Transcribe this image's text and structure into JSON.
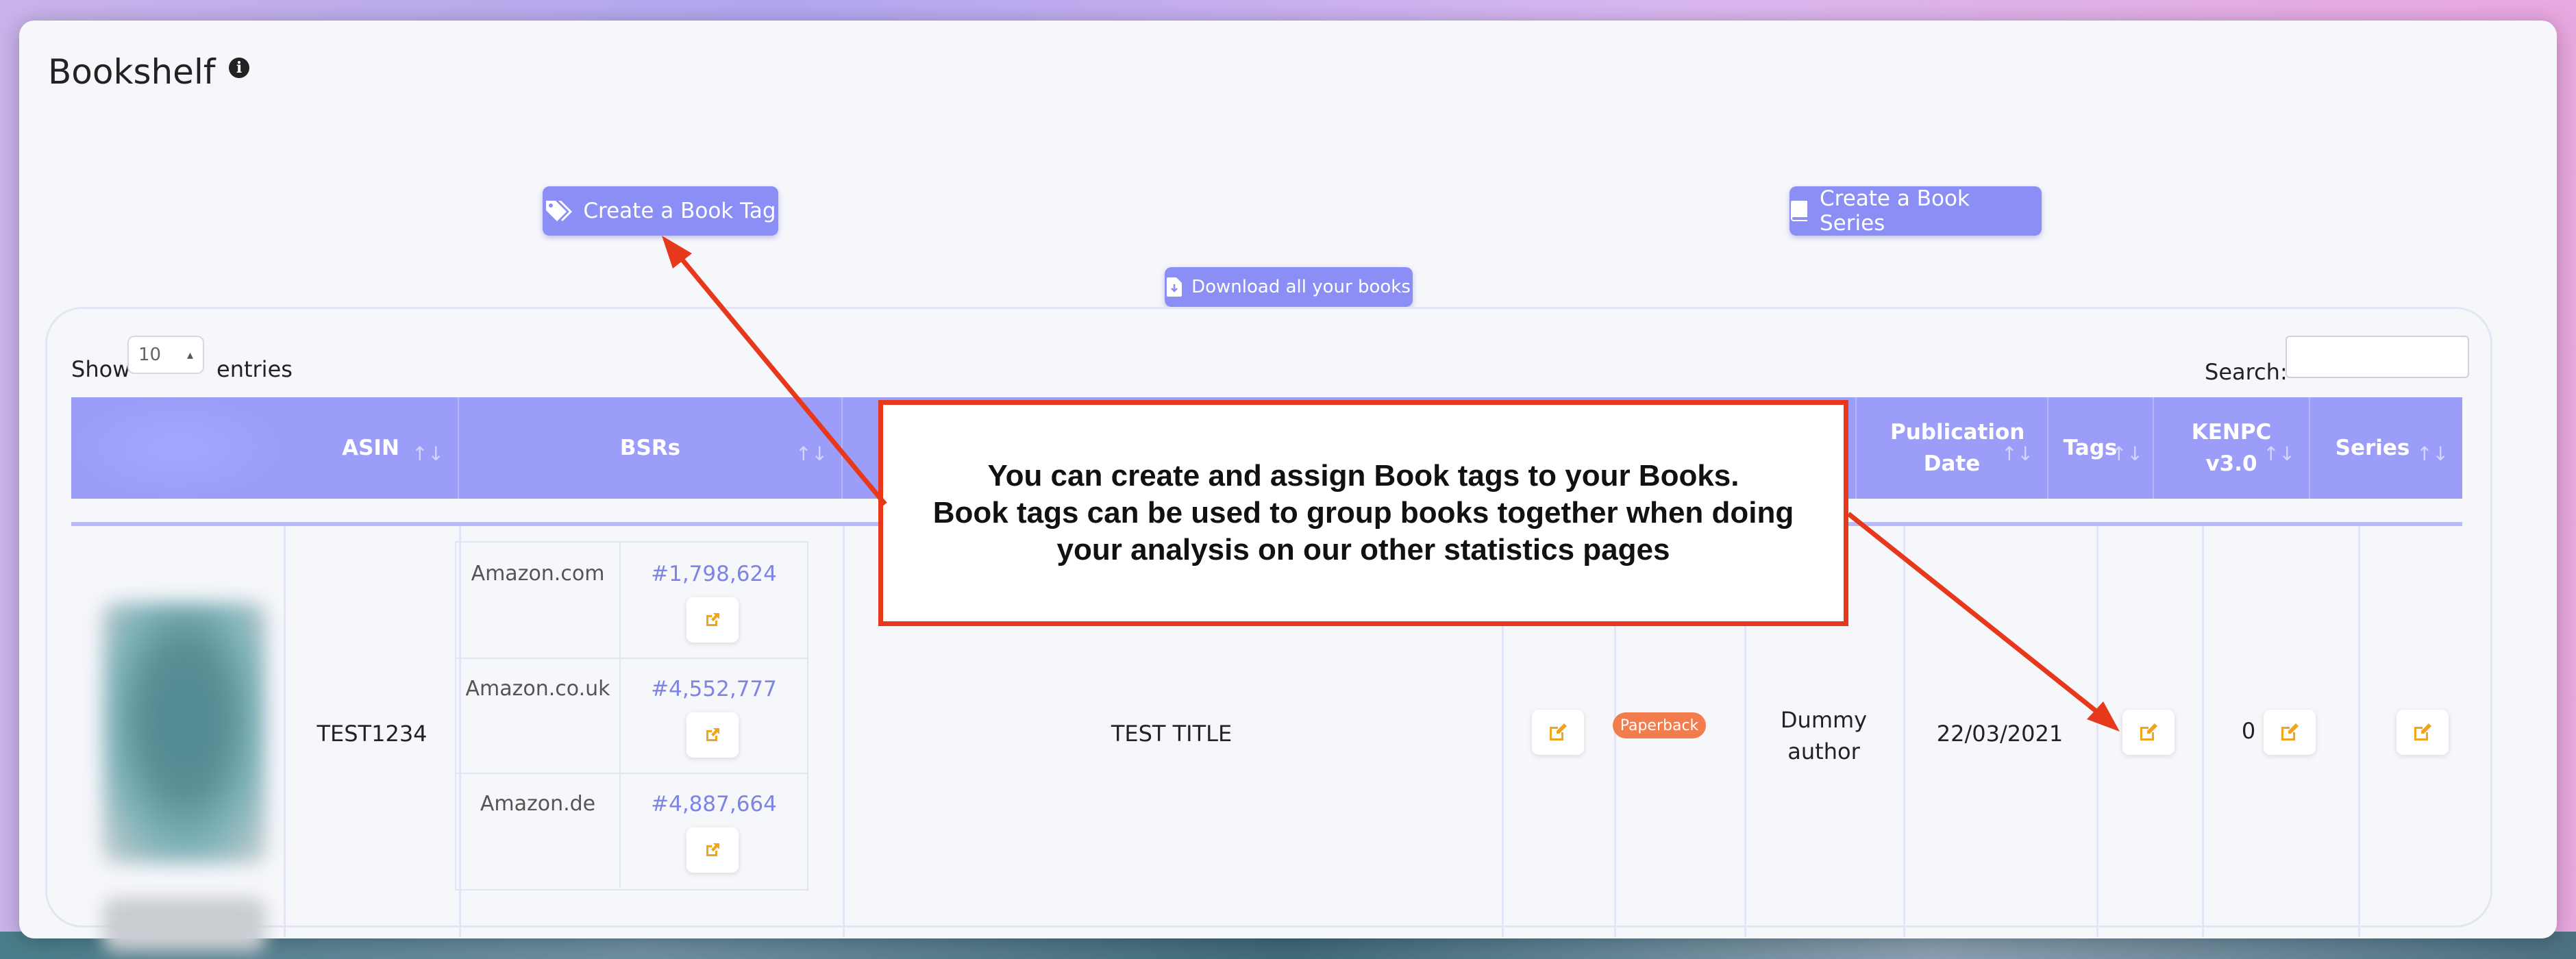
{
  "page": {
    "title": "Bookshelf"
  },
  "actions": {
    "create_tag": "Create a Book Tag",
    "create_series": "Create a Book Series",
    "download_all": "Download all your books"
  },
  "table_controls": {
    "show_label": "Show",
    "entries_value": "10",
    "entries_label": "entries",
    "search_label": "Search:"
  },
  "table": {
    "headers": {
      "asin": "ASIN",
      "bsrs": "BSRs",
      "publication_date": "Publication Date",
      "tags": "Tags",
      "kenpc": "KENPC v3.0",
      "series": "Series"
    },
    "rows": [
      {
        "asin": "TEST1234",
        "bsrs": [
          {
            "market": "Amazon.com",
            "rank": "#1,798,624"
          },
          {
            "market": "Amazon.co.uk",
            "rank": "#4,552,777"
          },
          {
            "market": "Amazon.de",
            "rank": "#4,887,664"
          }
        ],
        "title": "TEST TITLE",
        "format": "Paperback",
        "author": "Dummy author",
        "publication_date": "22/03/2021",
        "kenpc": "0"
      }
    ]
  },
  "callout": {
    "text": "You can create and assign Book tags to your Books.\nBook tags can be used to group books together when doing your analysis on our other statistics pages"
  },
  "colors": {
    "accent": "#8b8ef5",
    "header": "#9b9df8",
    "callout_border": "#e8381c",
    "badge": "#f37c4c",
    "edit_icon": "#f0a51c"
  }
}
